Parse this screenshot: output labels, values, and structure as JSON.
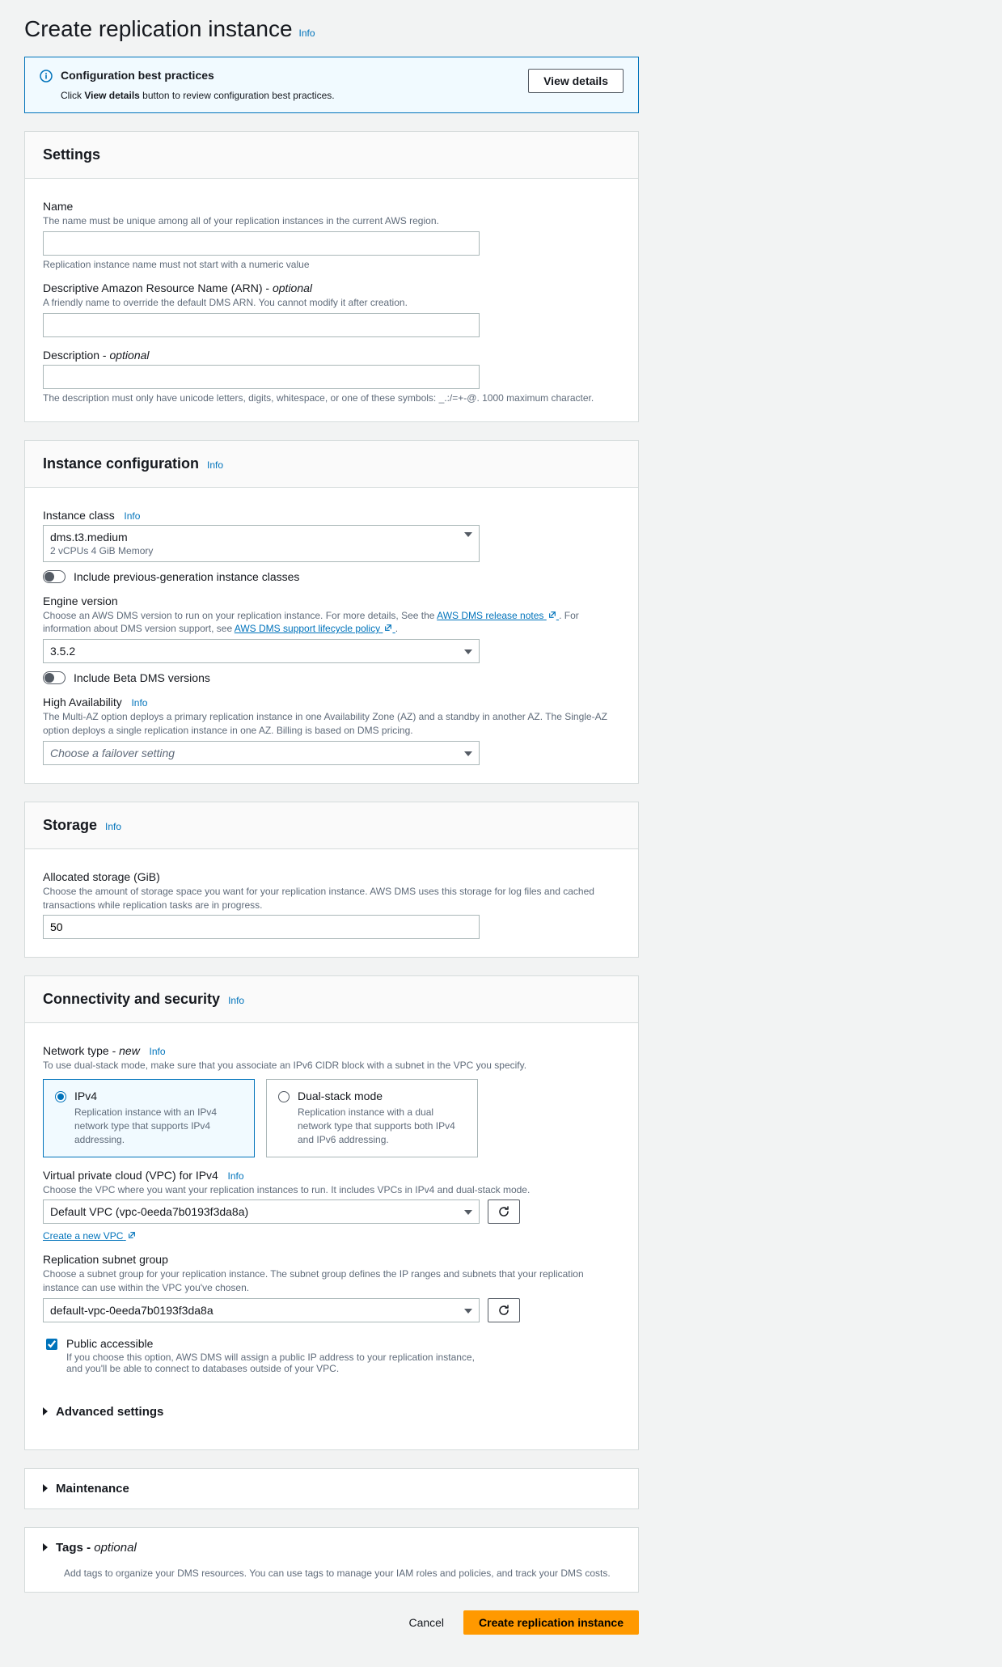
{
  "page": {
    "title": "Create replication instance",
    "info": "Info"
  },
  "banner": {
    "title": "Configuration best practices",
    "desc_prefix": "Click ",
    "desc_bold": "View details",
    "desc_suffix": " button to review configuration best practices.",
    "button": "View details"
  },
  "settings": {
    "header": "Settings",
    "name": {
      "label": "Name",
      "desc": "The name must be unique among all of your replication instances in the current AWS region.",
      "value": "",
      "help": "Replication instance name must not start with a numeric value"
    },
    "arn": {
      "label": "Descriptive Amazon Resource Name (ARN) - ",
      "optional": "optional",
      "desc": "A friendly name to override the default DMS ARN. You cannot modify it after creation.",
      "value": ""
    },
    "description": {
      "label": "Description - ",
      "optional": "optional",
      "value": "",
      "help": "The description must only have unicode letters, digits, whitespace, or one of these symbols: _.:/=+-@. 1000 maximum character."
    }
  },
  "instance": {
    "header": "Instance configuration",
    "info": "Info",
    "class": {
      "label": "Instance class",
      "info": "Info",
      "value": "dms.t3.medium",
      "sub": "2 vCPUs    4 GiB Memory",
      "toggle": "Include previous-generation instance classes"
    },
    "engine": {
      "label": "Engine version",
      "desc1": "Choose an AWS DMS version to run on your replication instance. For more details, See the ",
      "link1": "AWS DMS release notes",
      "desc2": ". For information about DMS version support, see ",
      "link2": "AWS DMS support lifecycle policy",
      "desc3": ".",
      "value": "3.5.2",
      "toggle": "Include Beta DMS versions"
    },
    "ha": {
      "label": "High Availability",
      "info": "Info",
      "desc": "The Multi-AZ option deploys a primary replication instance in one Availability Zone (AZ) and a standby in another AZ. The Single-AZ option deploys a single replication instance in one AZ. Billing is based on DMS pricing.",
      "placeholder": "Choose a failover setting"
    }
  },
  "storage": {
    "header": "Storage",
    "info": "Info",
    "allocated": {
      "label": "Allocated storage (GiB)",
      "desc": "Choose the amount of storage space you want for your replication instance. AWS DMS uses this storage for log files and cached transactions while replication tasks are in progress.",
      "value": "50"
    }
  },
  "connectivity": {
    "header": "Connectivity and security",
    "info": "Info",
    "network": {
      "label": "Network type - ",
      "new": "new",
      "info": "Info",
      "desc": "To use dual-stack mode, make sure that you associate an IPv6 CIDR block with a subnet in the VPC you specify.",
      "ipv4": {
        "title": "IPv4",
        "desc": "Replication instance with an IPv4 network type that supports IPv4 addressing."
      },
      "dual": {
        "title": "Dual-stack mode",
        "desc": "Replication instance with a dual network type that supports both IPv4 and IPv6 addressing."
      }
    },
    "vpc": {
      "label": "Virtual private cloud (VPC) for IPv4",
      "info": "Info",
      "desc": "Choose the VPC where you want your replication instances to run. It includes VPCs in IPv4 and dual-stack mode.",
      "value": "Default VPC (vpc-0eeda7b0193f3da8a)",
      "create_link": "Create a new VPC"
    },
    "subnet": {
      "label": "Replication subnet group",
      "desc": "Choose a subnet group for your replication instance. The subnet group defines the IP ranges and subnets that your replication instance can use within the VPC you've chosen.",
      "value": "default-vpc-0eeda7b0193f3da8a"
    },
    "public": {
      "label": "Public accessible",
      "desc": "If you choose this option, AWS DMS will assign a public IP address to your replication instance, and you'll be able to connect to databases outside of your VPC."
    },
    "advanced": "Advanced settings"
  },
  "maintenance": {
    "title": "Maintenance"
  },
  "tags": {
    "title": "Tags - ",
    "optional": "optional",
    "desc": "Add tags to organize your DMS resources. You can use tags to manage your IAM roles and policies, and track your DMS costs."
  },
  "footer": {
    "cancel": "Cancel",
    "create": "Create replication instance"
  }
}
